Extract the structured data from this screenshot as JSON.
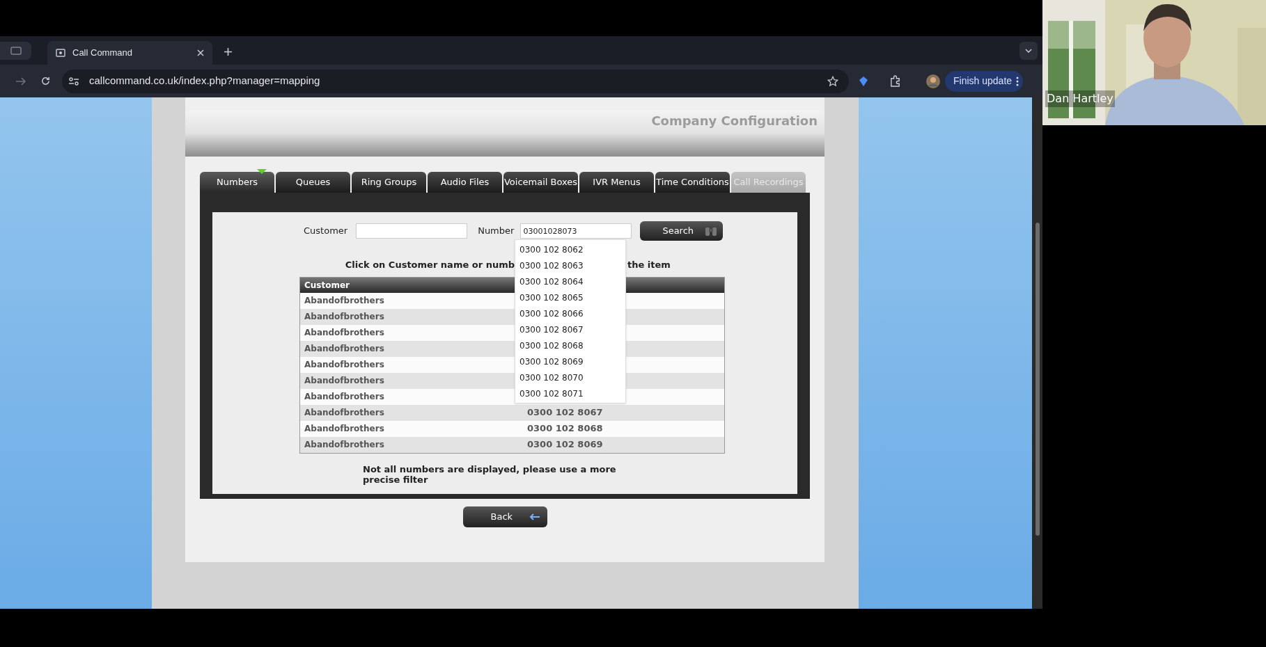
{
  "browser": {
    "tabs": [
      {
        "title": "Call Command",
        "selected": true
      }
    ],
    "address": "callcommand.co.uk/index.php?manager=mapping",
    "update_button": "Finish update"
  },
  "page": {
    "title": "Company Configuration",
    "tabs": [
      {
        "label": "Numbers",
        "selected": true,
        "disabled": false
      },
      {
        "label": "Queues",
        "selected": false,
        "disabled": false
      },
      {
        "label": "Ring Groups",
        "selected": false,
        "disabled": false
      },
      {
        "label": "Audio Files",
        "selected": false,
        "disabled": false
      },
      {
        "label": "Voicemail Boxes",
        "selected": false,
        "disabled": false
      },
      {
        "label": "IVR Menus",
        "selected": false,
        "disabled": false
      },
      {
        "label": "Time Conditions",
        "selected": false,
        "disabled": false
      },
      {
        "label": "Call Recordings",
        "selected": false,
        "disabled": true
      }
    ],
    "search": {
      "customer_label": "Customer",
      "number_label": "Number",
      "number_value": "03001028073",
      "button": "Search"
    },
    "suggestions": [
      "0300 102 8062",
      "0300 102 8063",
      "0300 102 8064",
      "0300 102 8065",
      "0300 102 8066",
      "0300 102 8067",
      "0300 102 8068",
      "0300 102 8069",
      "0300 102 8070",
      "0300 102 8071"
    ],
    "instruction_start": "Click on Customer name or numb",
    "instruction_end": "the item",
    "table": {
      "columns": [
        "Customer"
      ],
      "rows": [
        {
          "customer": "Abandofbrothers"
        },
        {
          "customer": "Abandofbrothers"
        },
        {
          "customer": "Abandofbrothers"
        },
        {
          "customer": "Abandofbrothers"
        },
        {
          "customer": "Abandofbrothers"
        },
        {
          "customer": "Abandofbrothers"
        },
        {
          "customer": "Abandofbrothers"
        },
        {
          "customer": "Abandofbrothers",
          "number": "0300 102 8067"
        },
        {
          "customer": "Abandofbrothers",
          "number": "0300 102 8068"
        },
        {
          "customer": "Abandofbrothers",
          "number": "0300 102 8069"
        }
      ]
    },
    "notice": "Not all numbers are displayed, please use a more precise filter",
    "back_button": "Back"
  },
  "video_call": {
    "participant_name": "Dan Hartley"
  }
}
